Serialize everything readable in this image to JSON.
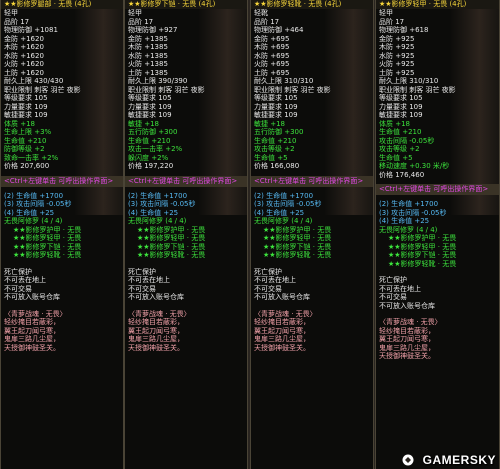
{
  "panels": [
    {
      "title": "★★影修罗腿部 · 无畏 (4孔)",
      "header": [
        "轻甲",
        "品阶 17",
        "物理防御 +1081",
        "金防 +1620",
        "木防 +1620",
        "水防 +1620",
        "火防 +1620",
        "土防 +1620",
        "耐久上限 430/430",
        "职业限制 刺客 羽芒 夜影",
        "等级要求 105",
        "力量要求 109",
        "敏捷要求 109"
      ],
      "green": [
        "体质 +18",
        "生命上限 +3%",
        "生命值 +210",
        "防御等级 +2",
        "致命一击率 +2%"
      ],
      "price": "价格 207,600",
      "band": "<Ctrl+左键单击 可呼出操作界面>",
      "blue": [
        "(2) 生命值 +1700",
        "(3) 攻击间隔 -0.05秒",
        "(4) 生命值 +25"
      ],
      "set_name": "无畏阿修罗 (4 / 4)",
      "set_items": [
        "★★影修罗护甲 · 无畏",
        "★★影修罗轻甲 · 无畏",
        "★★影修罗下铠 · 无畏",
        "★★影修罗轻靴 · 无畏"
      ],
      "white_bottom": [
        "死亡保护",
        "不可丢在地上",
        "不可交易",
        "不可放入账号仓库"
      ],
      "lore": [
        "〈青萝战魂 · 无畏〉",
        "轻纱掩目若蔽彩，",
        "翼王起刀闻弓寒，",
        "鬼扉三路几尘屋，",
        "天授御神鼓圣关。"
      ]
    },
    {
      "title": "★★影修罗下铠 · 无畏 (4孔)",
      "header": [
        "轻甲",
        "品阶 17",
        "物理防御 +927",
        "金防 +1385",
        "木防 +1385",
        "水防 +1385",
        "火防 +1385",
        "土防 +1385",
        "耐久上限 390/390",
        "职业限制 刺客 羽芒 夜影",
        "等级要求 105",
        "力量要求 109",
        "敏捷要求 109"
      ],
      "green": [
        "敏捷 +18",
        "五行防御 +300",
        "生命值 +210",
        "攻击一击率 +2%",
        "躲闪度 +2%"
      ],
      "price": "价格 197,220",
      "band": "<Ctrl+左键单击 可呼出操作界面>",
      "blue": [
        "(2) 生命值 +1700",
        "(3) 攻击间隔 -0.05秒",
        "(4) 生命值 +25"
      ],
      "set_name": "无畏阿修罗 (4 / 4)",
      "set_items": [
        "★★影修罗护甲 · 无畏",
        "★★影修罗轻甲 · 无畏",
        "★★影修罗下铠 · 无畏",
        "★★影修罗轻靴 · 无畏"
      ],
      "white_bottom": [
        "死亡保护",
        "不可丢在地上",
        "不可交易",
        "不可放入账号仓库"
      ],
      "lore": [
        "〈青萝战魂 · 无畏〉",
        "轻纱掩目若蔽彩，",
        "翼王起刀闻弓寒，",
        "鬼扉三路几尘屋，",
        "天授御神鼓圣关。"
      ]
    },
    {
      "title": "★★影修罗轻靴 · 无畏 (4孔)",
      "header": [
        "轻靴",
        "品阶 17",
        "物理防御 +464",
        "金防 +695",
        "木防 +695",
        "水防 +695",
        "火防 +695",
        "土防 +695",
        "耐久上限 310/310",
        "职业限制 刺客 羽芒 夜影",
        "等级要求 105",
        "力量要求 109",
        "敏捷要求 109"
      ],
      "green": [
        "敏捷 +18",
        "五行防御 +300",
        "生命值 +210",
        "攻击等级 +2",
        "生命值 +5"
      ],
      "price": "价格 166,080",
      "band": "<Ctrl+左键单击 可呼出操作界面>",
      "blue": [
        "(2) 生命值 +1700",
        "(3) 攻击间隔 -0.05秒",
        "(4) 生命值 +25"
      ],
      "set_name": "无畏阿修罗 (4 / 4)",
      "set_items": [
        "★★影修罗护甲 · 无畏",
        "★★影修罗轻甲 · 无畏",
        "★★影修罗下铠 · 无畏",
        "★★影修罗轻靴 · 无畏"
      ],
      "white_bottom": [
        "死亡保护",
        "不可丢在地上",
        "不可交易",
        "不可放入账号仓库"
      ],
      "lore": [
        "〈青萝战魂 · 无畏〉",
        "轻纱掩目若蔽彩，",
        "翼王起刀闻弓寒，",
        "鬼扉三路几尘屋，",
        "天授御神鼓圣关。"
      ]
    },
    {
      "title": "★★影修罗轻甲 · 无畏 (4孔)",
      "header": [
        "轻甲",
        "品阶 17",
        "物理防御 +618",
        "金防 +925",
        "木防 +925",
        "水防 +925",
        "火防 +925",
        "土防 +925",
        "耐久上限 310/310",
        "职业限制 刺客 羽芒 夜影",
        "等级要求 105",
        "力量要求 109",
        "敏捷要求 109"
      ],
      "green": [
        "体质 +18",
        "生命值 +210",
        "攻击间隔 -0.05秒",
        "攻击等级 +2",
        "生命值 +5",
        "移动速度 +0.30 米/秒"
      ],
      "price": "价格 176,460",
      "band": "<Ctrl+左键单击 可呼出操作界面>",
      "blue": [
        "(2) 生命值 +1700",
        "(3) 攻击间隔 -0.05秒",
        "(4) 生命值 +25"
      ],
      "set_name": "无畏阿修罗 (4 / 4)",
      "set_items": [
        "★★影修罗护甲 · 无畏",
        "★★影修罗轻甲 · 无畏",
        "★★影修罗下铠 · 无畏",
        "★★影修罗轻靴 · 无畏"
      ],
      "white_bottom": [
        "死亡保护",
        "不可丢在地上",
        "不可交易",
        "不可放入账号仓库"
      ],
      "lore": [
        "〈青萝战魂 · 无畏〉",
        "轻纱掩目若蔽彩，",
        "翼王起刀闻弓寒，",
        "鬼扉三路几尘屋，",
        "天授御神鼓圣关。"
      ]
    }
  ],
  "watermark": "GAMERSKY"
}
